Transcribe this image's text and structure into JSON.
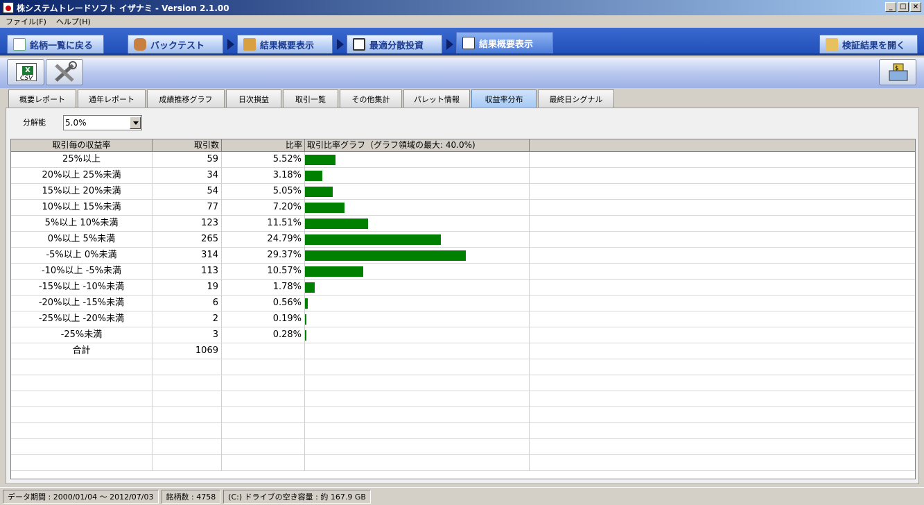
{
  "window": {
    "title": "株システムトレードソフト イザナミ - Version 2.1.00"
  },
  "menu": {
    "items": [
      "ファイル(F)",
      "ヘルプ(H)"
    ]
  },
  "top_tabs": [
    {
      "label": "銘柄一覧に戻る"
    },
    {
      "label": "バックテスト"
    },
    {
      "label": "結果概要表示"
    },
    {
      "label": "最適分散投資"
    },
    {
      "label": "結果概要表示"
    },
    {
      "label": "検証結果を開く"
    }
  ],
  "toolbar": {
    "csv_label": "CSV"
  },
  "sub_tabs": [
    "概要レポート",
    "通年レポート",
    "成績推移グラフ",
    "日次損益",
    "取引一覧",
    "その他集計",
    "パレット情報",
    "収益率分布",
    "最終日シグナル"
  ],
  "resolution": {
    "label": "分解能",
    "value": "5.0%"
  },
  "table": {
    "headers": [
      "取引毎の収益率",
      "取引数",
      "比率",
      "取引比率グラフ（グラフ領域の最大: 40.0%)"
    ],
    "graph_max_percent": 40.0,
    "rows": [
      {
        "range": "25%以上",
        "count": "59",
        "ratio": "5.52%",
        "pct": 5.52
      },
      {
        "range": "20%以上 25%未満",
        "count": "34",
        "ratio": "3.18%",
        "pct": 3.18
      },
      {
        "range": "15%以上 20%未満",
        "count": "54",
        "ratio": "5.05%",
        "pct": 5.05
      },
      {
        "range": "10%以上 15%未満",
        "count": "77",
        "ratio": "7.20%",
        "pct": 7.2
      },
      {
        "range": "5%以上 10%未満",
        "count": "123",
        "ratio": "11.51%",
        "pct": 11.51
      },
      {
        "range": "0%以上 5%未満",
        "count": "265",
        "ratio": "24.79%",
        "pct": 24.79
      },
      {
        "range": "-5%以上 0%未満",
        "count": "314",
        "ratio": "29.37%",
        "pct": 29.37
      },
      {
        "range": "-10%以上 -5%未満",
        "count": "113",
        "ratio": "10.57%",
        "pct": 10.57
      },
      {
        "range": "-15%以上 -10%未満",
        "count": "19",
        "ratio": "1.78%",
        "pct": 1.78
      },
      {
        "range": "-20%以上 -15%未満",
        "count": "6",
        "ratio": "0.56%",
        "pct": 0.56
      },
      {
        "range": "-25%以上 -20%未満",
        "count": "2",
        "ratio": "0.19%",
        "pct": 0.19
      },
      {
        "range": "-25%未満",
        "count": "3",
        "ratio": "0.28%",
        "pct": 0.28
      },
      {
        "range": "合計",
        "count": "1069",
        "ratio": "",
        "pct": null
      }
    ]
  },
  "status": {
    "period": "データ期間 : 2000/01/04 〜 2012/07/03",
    "stocks": "銘柄数 : 4758",
    "drive": "(C:) ドライブの空き容量 : 約 167.9 GB"
  },
  "colors": {
    "bar": "#008000",
    "tab_active": "#4a7ad8"
  }
}
